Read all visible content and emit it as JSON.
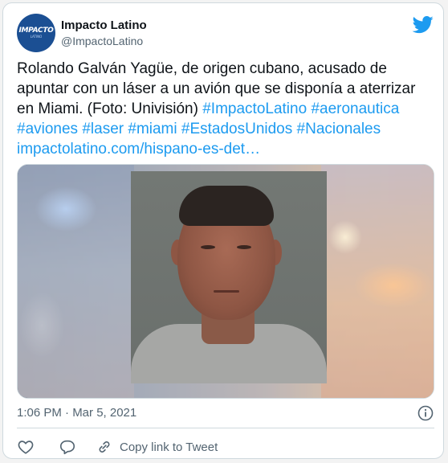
{
  "tweet": {
    "author": {
      "name": "Impacto Latino",
      "handle": "@ImpactoLatino",
      "avatar_text": "IMPACTO",
      "avatar_subtext": "LATINO"
    },
    "text_plain": "Rolando Galván Yagüe, de origen cubano, acusado de apuntar con un láser a un avión que se disponía a aterrizar en Miami. (Foto: Univisión) ",
    "hashtags": [
      "#ImpactoLatino",
      "#aeronautica",
      "#aviones",
      "#laser",
      "#miami",
      "#EstadosUnidos",
      "#Nacionales"
    ],
    "link": "impactolatino.com/hispano-es-det…",
    "timestamp": "1:06 PM · Mar 5, 2021",
    "actions": {
      "like_icon": "heart-icon",
      "reply_icon": "reply-icon",
      "copy_icon": "link-icon",
      "copy_label": "Copy link to Tweet"
    }
  },
  "colors": {
    "brand_blue": "#1d9bf0",
    "text": "#0f1419",
    "secondary": "#536471",
    "border": "#cfd9de",
    "avatar_bg": "#1b4f93"
  }
}
